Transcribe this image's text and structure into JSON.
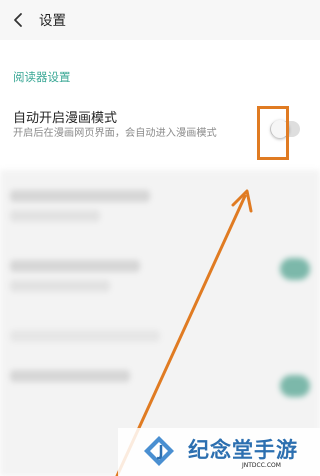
{
  "header": {
    "title": "设置",
    "back_icon": "chevron-left-icon"
  },
  "section": {
    "label": "阅读器设置"
  },
  "setting": {
    "title": "自动开启漫画模式",
    "description": "开启后在漫画网页界面，会自动进入漫画模式",
    "toggle_state": "off"
  },
  "watermark": {
    "name": "纪念堂手游",
    "site": "JNTDCC.COM"
  },
  "colors": {
    "accent": "#3ba896",
    "annotation": "#e07b22"
  }
}
